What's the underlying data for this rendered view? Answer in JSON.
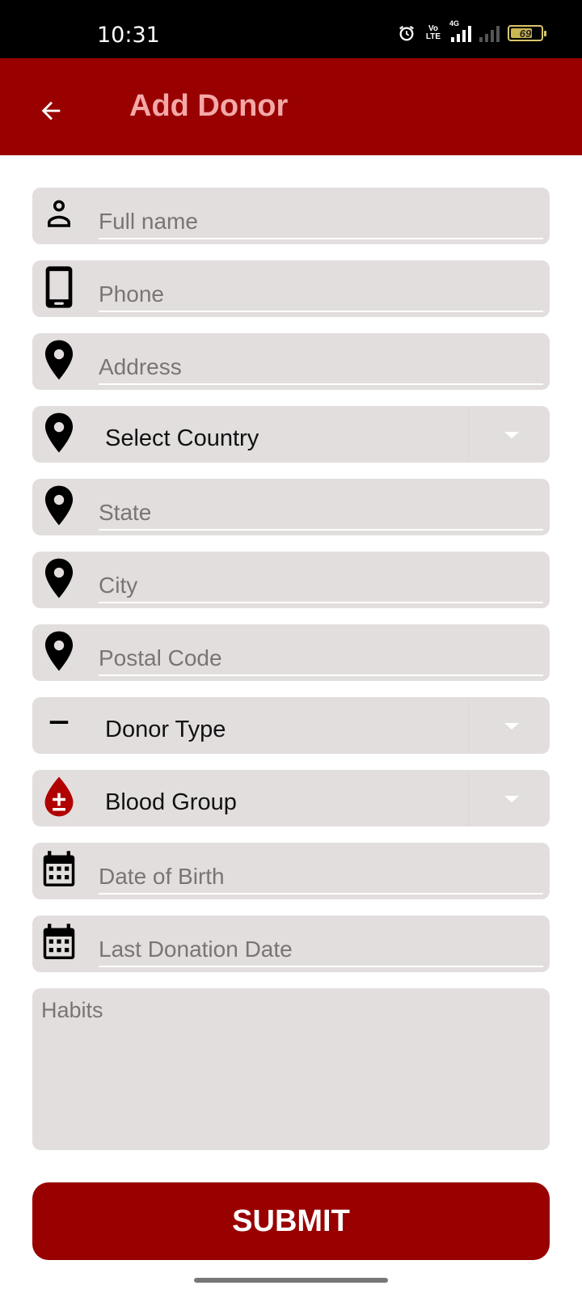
{
  "status_bar": {
    "time": "10:31",
    "volte_label": "Vo LTE",
    "network_label": "4G",
    "battery_level": "69",
    "icons": [
      "alarm-icon",
      "volte-icon",
      "signal-icon",
      "signal-icon",
      "battery-icon"
    ]
  },
  "app_bar": {
    "title": "Add Donor",
    "back_icon": "back-arrow-icon",
    "color": "#990000",
    "title_color": "#f4a8a8"
  },
  "form": {
    "full_name": {
      "placeholder": "Full name",
      "icon": "person-icon"
    },
    "phone": {
      "placeholder": "Phone",
      "icon": "phone-icon"
    },
    "address": {
      "placeholder": "Address",
      "icon": "location-pin-icon"
    },
    "country": {
      "selected": "Select Country",
      "icon": "location-pin-icon"
    },
    "state": {
      "placeholder": "State",
      "icon": "location-pin-icon"
    },
    "city": {
      "placeholder": "City",
      "icon": "location-pin-icon"
    },
    "postal_code": {
      "placeholder": "Postal Code",
      "icon": "location-pin-icon"
    },
    "donor_type": {
      "selected": "Donor Type",
      "icon": "minus-icon"
    },
    "blood_group": {
      "selected": "Blood Group",
      "icon": "blood-drop-icon"
    },
    "date_of_birth": {
      "placeholder": "Date of Birth",
      "icon": "calendar-icon"
    },
    "last_donation_date": {
      "placeholder": "Last Donation Date",
      "icon": "calendar-icon"
    },
    "habits": {
      "placeholder": "Habits"
    }
  },
  "submit": {
    "label": "SUBMIT"
  },
  "colors": {
    "primary": "#990000",
    "field_bg": "#e3dede",
    "placeholder": "#7a7474",
    "blood_drop": "#b00000"
  }
}
